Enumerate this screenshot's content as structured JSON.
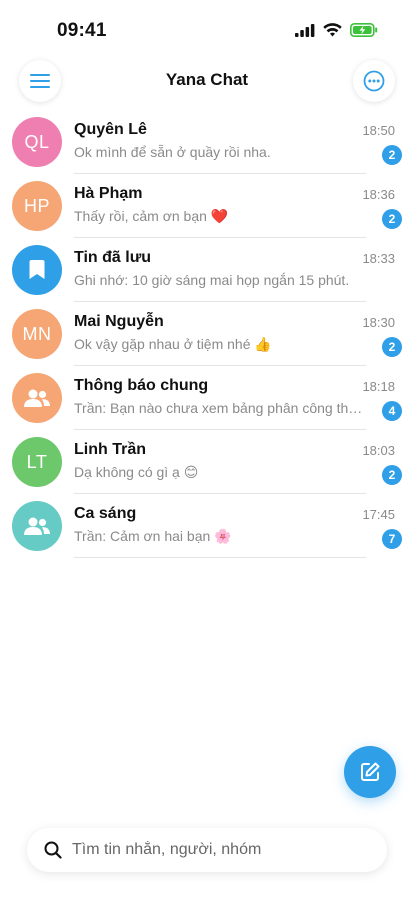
{
  "status_bar": {
    "time": "09:41"
  },
  "header": {
    "title": "Yana Chat"
  },
  "chats": [
    {
      "initials": "QL",
      "name": "Quyên Lê",
      "time": "18:50",
      "preview": "Ok mình để sẵn ở quầy rồi nha.",
      "unread": "2",
      "avatar_color": "#ef7fb0"
    },
    {
      "initials": "HP",
      "name": "Hà Phạm",
      "time": "18:36",
      "preview": "Thấy rồi, cảm ơn bạn ❤️",
      "unread": "2",
      "avatar_color": "#f6a674"
    },
    {
      "icon": "bookmark-icon",
      "name": "Tin đã lưu",
      "time": "18:33",
      "preview": "Ghi nhớ: 10 giờ sáng mai họp ngắn 15 phút.",
      "avatar_color": "#2f9fe8"
    },
    {
      "initials": "MN",
      "name": "Mai Nguyễn",
      "time": "18:30",
      "preview": "Ok vậy gặp nhau ở tiệm nhé 👍",
      "unread": "2",
      "avatar_color": "#f6a674"
    },
    {
      "icon": "group-icon",
      "name": "Thông báo chung",
      "time": "18:18",
      "preview": "Trần:  Bạn nào chưa xem bảng phân công thì xem nhé",
      "unread": "4",
      "avatar_color": "#f6a674"
    },
    {
      "initials": "LT",
      "name": "Linh Trần",
      "time": "18:03",
      "preview": "Dạ không có gì ạ 😊",
      "unread": "2",
      "avatar_color": "#6cc86a"
    },
    {
      "icon": "group-icon",
      "name": "Ca sáng",
      "time": "17:45",
      "preview": "Trần:  Cảm ơn hai bạn 🌸",
      "unread": "7",
      "avatar_color": "#66cbc4"
    }
  ],
  "search": {
    "placeholder": "Tìm tin nhắn, người, nhóm"
  },
  "colors": {
    "accent": "#2f9fe8",
    "battery": "#3cc13b"
  },
  "icons": [
    "hamburger-menu-icon",
    "more-options-icon",
    "compose-icon",
    "search-icon",
    "signal-icon",
    "wifi-icon",
    "battery-charging-icon"
  ]
}
